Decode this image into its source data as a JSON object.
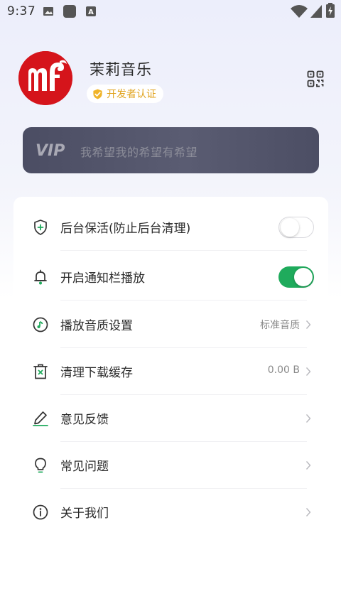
{
  "status_bar": {
    "time": "9:37",
    "left_icons": [
      "image-icon",
      "app-square-icon",
      "keyboard-a-icon"
    ],
    "right_icons": [
      "wifi-icon",
      "signal-icon",
      "battery-charging-icon"
    ]
  },
  "profile": {
    "app_name": "茉莉音乐",
    "badge_label": "开发者认证",
    "badge_color": "#e0a21b",
    "avatar_color": "#d5141b"
  },
  "vip": {
    "logo_text": "VIP",
    "slogan": "我希望我的希望有希望"
  },
  "settings": {
    "keep_alive": {
      "label": "后台保活(防止后台清理)",
      "enabled": false
    },
    "notification_play": {
      "label": "开启通知栏播放",
      "enabled": true
    },
    "audio_quality": {
      "label": "播放音质设置",
      "value": "标准音质"
    },
    "clear_cache": {
      "label": "清理下载缓存",
      "value": "0.00 B"
    },
    "feedback": {
      "label": "意见反馈"
    },
    "faq": {
      "label": "常见问题"
    },
    "about": {
      "label": "关于我们"
    }
  },
  "colors": {
    "accent_green": "#1fab5c",
    "vip_banner": "#505268",
    "brand_red": "#d5141b"
  }
}
